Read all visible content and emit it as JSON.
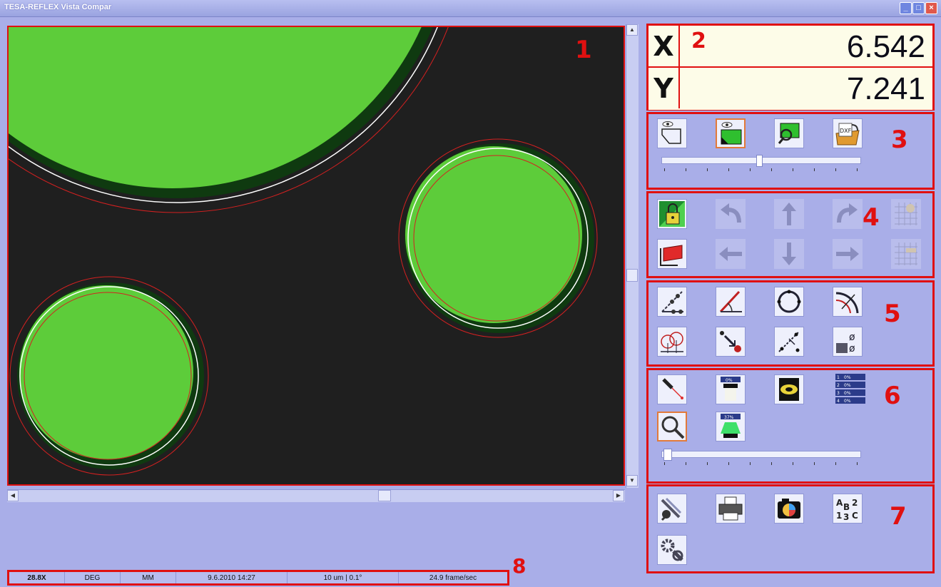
{
  "window": {
    "title": "TESA-REFLEX Vista Compar"
  },
  "panel_numbers": {
    "p1": "1",
    "p2": "2",
    "p3": "3",
    "p4": "4",
    "p5": "5",
    "p6": "6",
    "p7": "7",
    "p8": "8"
  },
  "coords": {
    "x_label": "X",
    "x_value": "6.542",
    "y_label": "Y",
    "y_value": "7.241"
  },
  "lighting": {
    "top_light_pct": "0%",
    "bottom_light_pct": "37%",
    "ring": [
      {
        "n": "1",
        "v": "0%"
      },
      {
        "n": "2",
        "v": "0%"
      },
      {
        "n": "3",
        "v": "0%"
      },
      {
        "n": "4",
        "v": "0%"
      }
    ]
  },
  "status": {
    "zoom": "28.8X",
    "angle_unit": "DEG",
    "length_unit": "MM",
    "datetime": "9.6.2010  14:27",
    "resolution": "10 um  |  0.1°",
    "framerate": "24.9 frame/sec"
  },
  "colors": {
    "frame": "#e01010",
    "background": "#a9aee8",
    "part": "#5dcc3a"
  }
}
